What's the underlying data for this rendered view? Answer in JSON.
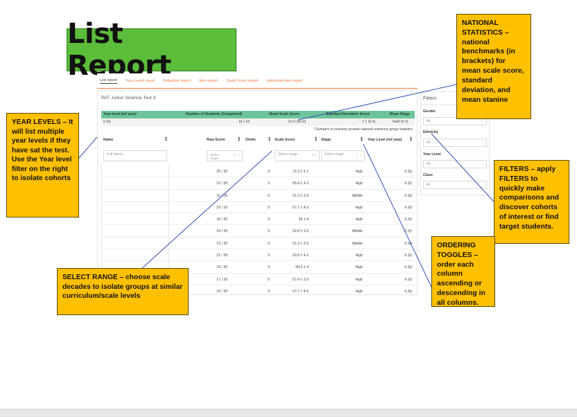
{
  "title": "List Report",
  "callouts": {
    "national": "NATIONAL STATISTICS – national benchmarks (in brackets) for mean scale score, standard deviation, and mean stanine",
    "year_levels": "YEAR LEVELS – It will list multiple year levels if they have sat the test. Use the Year level filter on the right to isolate cohorts",
    "filters": "FILTERS – apply FILTERS to quickly make comparisons and discover cohorts of interest or find target students.",
    "ordering": "ORDERING TOGGLES – order each column ascending or descending in all columns.",
    "select_range": "SELECT RANGE – choose scale decades to isolate groups at similar curriculum/scale levels"
  },
  "tabs": [
    "List report",
    "Year Level report",
    "Individual report",
    "Item report",
    "Scale Score report",
    "Individual Item report"
  ],
  "test_name": "PAT Junior Science Test 3",
  "summary": {
    "headers": {
      "year_level": "Year level",
      "ref_year": "(ref year)",
      "num_students": "Number of Students (Completed)",
      "mean_scale": "Mean Scale Score",
      "std_dev": "Standard Deviation Score",
      "mean_stage": "Mean Stage"
    },
    "row": {
      "year_level": "6",
      "ref": "(6)",
      "num_students": "16 / 16",
      "mean_scale": "61.5 (50.0)",
      "std_dev": "7.1 (9.4)",
      "mean_stage": "NaN (5.0)"
    },
    "note": "* Numbers in brackets provide national reference group statistics"
  },
  "table": {
    "headers": {
      "name": "Name",
      "raw": "Raw Score",
      "omits": "Omits",
      "scale": "Scale Score",
      "stage": "Stage",
      "year_level": "Year Level",
      "year_level_ref": "(ref year)"
    },
    "placeholders": {
      "name": "Full Name...",
      "raw": "Select range",
      "scale": "Select range",
      "stage": "Select stage"
    },
    "rows": [
      {
        "raw": "25 / 30",
        "omits": "0",
        "scale": "72.3 ± 5.1",
        "stage": "High",
        "year": "6",
        "ref": "(6)"
      },
      {
        "raw": "22 / 30",
        "omits": "0",
        "scale": "65.8 ± 4.3",
        "stage": "High",
        "year": "6",
        "ref": "(6)"
      },
      {
        "raw": "15 / 30",
        "omits": "0",
        "scale": "51.3 ± 3.9",
        "stage": "Middle",
        "year": "6",
        "ref": "(6)"
      },
      {
        "raw": "23 / 30",
        "omits": "0",
        "scale": "67.7 ± 4.5",
        "stage": "High",
        "year": "6",
        "ref": "(6)"
      },
      {
        "raw": "18 / 30",
        "omits": "0",
        "scale": "59 ± 4",
        "stage": "High",
        "year": "6",
        "ref": "(6)"
      },
      {
        "raw": "14 / 30",
        "omits": "0",
        "scale": "52.8 ± 3.9",
        "stage": "Middle",
        "year": "6",
        "ref": "(6)"
      },
      {
        "raw": "13 / 30",
        "omits": "0",
        "scale": "51.3 ± 3.9",
        "stage": "Middle",
        "year": "6",
        "ref": "(6)"
      },
      {
        "raw": "21 / 30",
        "omits": "0",
        "scale": "63.9 ± 4.2",
        "stage": "High",
        "year": "6",
        "ref": "(6)"
      },
      {
        "raw": "19 / 30",
        "omits": "0",
        "scale": "60.5 ± 4",
        "stage": "High",
        "year": "6",
        "ref": "(6)"
      },
      {
        "raw": "17 / 30",
        "omits": "0",
        "scale": "57.4 ± 3.9",
        "stage": "High",
        "year": "6",
        "ref": "(6)"
      },
      {
        "raw": "23 / 30",
        "omits": "0",
        "scale": "67.7 ± 4.5",
        "stage": "High",
        "year": "6",
        "ref": "(6)"
      },
      {
        "raw": "24 / 30",
        "omits": "0",
        "scale": "69.9 ± 4.8",
        "stage": "High",
        "year": "6",
        "ref": "(6)"
      }
    ]
  },
  "filters_panel": {
    "title": "Filters",
    "gender": "Gender",
    "ethnicity": "Ethnicity",
    "year_level": "Year Level",
    "class": "Class",
    "all": "All"
  },
  "colors": {
    "title_bg": "#5bbd3a",
    "callout_bg": "#ffc000",
    "tab_accent": "#ec7b3d",
    "summary_header": "#6ec49a",
    "leader_line": "#2f4fb4"
  }
}
